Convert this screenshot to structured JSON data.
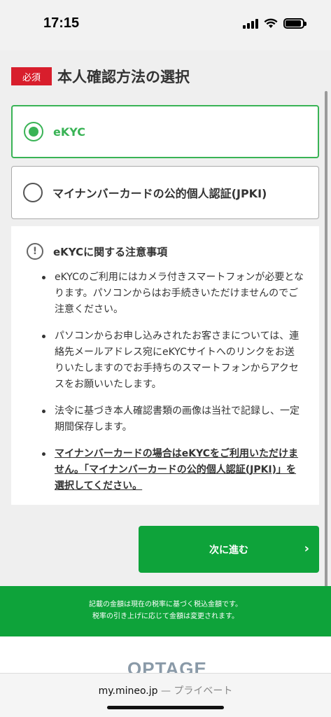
{
  "status_bar": {
    "time": "17:15"
  },
  "section": {
    "required_badge": "必須",
    "title": "本人確認方法の選択"
  },
  "options": [
    {
      "label": "eKYC",
      "selected": true
    },
    {
      "label": "マイナンバーカードの公的個人認証(JPKI)",
      "selected": false
    }
  ],
  "notice": {
    "title": "eKYCに関する注意事項",
    "items": [
      "eKYCのご利用にはカメラ付きスマートフォンが必要となります。パソコンからはお手続きいただけませんのでご注意ください。",
      "パソコンからお申し込みされたお客さまについては、連絡先メールアドレス宛にeKYCサイトへのリンクをお送りいたしますのでお手持ちのスマートフォンからアクセスをお願いいたします。",
      "法令に基づき本人確認書類の画像は当社で記録し、一定期間保存します。",
      "マイナンバーカードの場合はeKYCをご利用いただけません。「マイナンバーカードの公的個人認証(JPKI)」を選択してください。"
    ]
  },
  "next_button": {
    "label": "次に進む",
    "arrow": "›"
  },
  "footer": {
    "line1": "記載の金額は現在の税率に基づく税込金額です。",
    "line2": "税率の引き上げに応じて金額は変更されます。",
    "logo_text": "OPTAGE"
  },
  "browser": {
    "url": "my.mineo.jp",
    "mode": "— プライベート"
  },
  "colors": {
    "accent": "#39b355",
    "button": "#0ea33a",
    "badge": "#d81e2c"
  }
}
